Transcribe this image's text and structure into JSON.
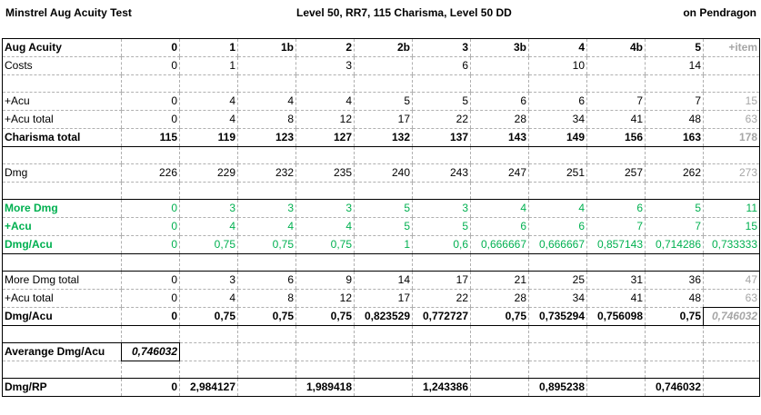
{
  "header": {
    "title": "Minstrel Aug Acuity Test",
    "center": "Level 50, RR7, 115 Charisma, Level 50 DD",
    "right": "on Pendragon"
  },
  "table": {
    "columns": [
      "Aug Acuity",
      "0",
      "1",
      "1b",
      "2",
      "2b",
      "3",
      "3b",
      "4",
      "4b",
      "5",
      "+item"
    ],
    "rows": {
      "costs": [
        "Costs",
        "0",
        "1",
        "",
        "3",
        "",
        "6",
        "",
        "10",
        "",
        "14",
        ""
      ],
      "acu": [
        "+Acu",
        "0",
        "4",
        "4",
        "4",
        "5",
        "5",
        "6",
        "6",
        "7",
        "7",
        "15"
      ],
      "acu_total": [
        "+Acu total",
        "0",
        "4",
        "8",
        "12",
        "17",
        "22",
        "28",
        "34",
        "41",
        "48",
        "63"
      ],
      "cha_total": [
        "Charisma total",
        "115",
        "119",
        "123",
        "127",
        "132",
        "137",
        "143",
        "149",
        "156",
        "163",
        "178"
      ],
      "dmg": [
        "Dmg",
        "226",
        "229",
        "232",
        "235",
        "240",
        "243",
        "247",
        "251",
        "257",
        "262",
        "273"
      ],
      "more_dmg": [
        "More Dmg",
        "0",
        "3",
        "3",
        "3",
        "5",
        "3",
        "4",
        "4",
        "6",
        "5",
        "11"
      ],
      "acu2": [
        "+Acu",
        "0",
        "4",
        "4",
        "4",
        "5",
        "5",
        "6",
        "6",
        "7",
        "7",
        "15"
      ],
      "dmg_acu": [
        "Dmg/Acu",
        "0",
        "0,75",
        "0,75",
        "0,75",
        "1",
        "0,6",
        "0,666667",
        "0,666667",
        "0,857143",
        "0,714286",
        "0,733333"
      ],
      "more_dmg_total": [
        "More Dmg total",
        "0",
        "3",
        "6",
        "9",
        "14",
        "17",
        "21",
        "25",
        "31",
        "36",
        "47"
      ],
      "acu_total2": [
        "+Acu total",
        "0",
        "4",
        "8",
        "12",
        "17",
        "22",
        "28",
        "34",
        "41",
        "48",
        "63"
      ],
      "dmg_acu2": [
        "Dmg/Acu",
        "0",
        "0,75",
        "0,75",
        "0,75",
        "0,823529",
        "0,772727",
        "0,75",
        "0,735294",
        "0,756098",
        "0,75",
        "0,746032"
      ],
      "avg": [
        "Averange Dmg/Acu",
        "0,746032"
      ],
      "dmg_rp": [
        "Dmg/RP",
        "0",
        "2,984127",
        "",
        "1,989418",
        "",
        "1,243386",
        "",
        "0,895238",
        "",
        "0,746032",
        ""
      ]
    }
  }
}
